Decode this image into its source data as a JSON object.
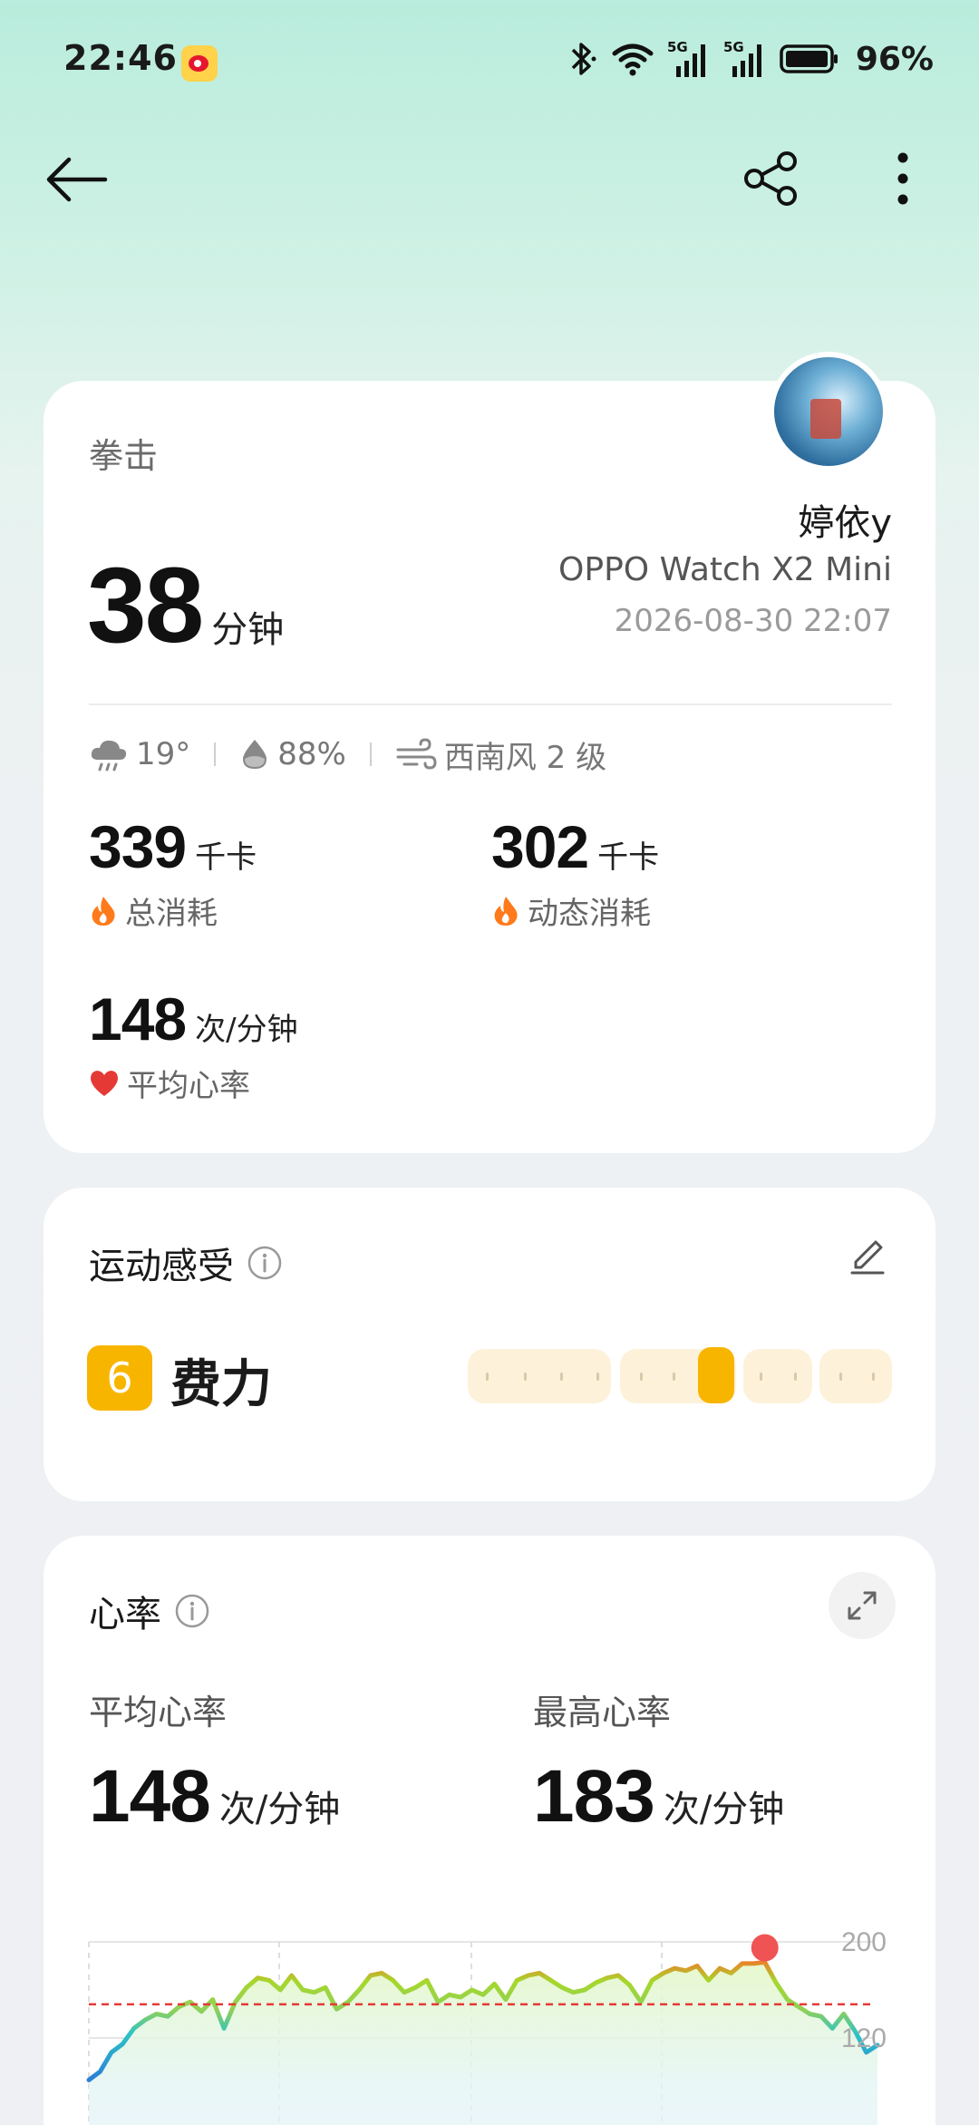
{
  "status_bar": {
    "time": "22:46",
    "battery_percent": "96%",
    "icons": [
      "weibo-icon",
      "bluetooth-icon",
      "wifi-icon",
      "signal-5g-icon",
      "signal-5g-icon",
      "battery-icon"
    ]
  },
  "toolbar": {
    "icons": [
      "back-arrow-icon",
      "share-icon",
      "more-vertical-icon"
    ]
  },
  "workout": {
    "sport": "拳击",
    "duration_value": "38",
    "duration_unit": "分钟",
    "user_name": "婷依y",
    "device": "OPPO Watch X2 Mini",
    "datetime": "2026-08-30 22:07",
    "weather": {
      "temperature": "19°",
      "humidity": "88%",
      "wind": "西南风 2 级"
    },
    "total_calories": {
      "value": "339",
      "unit": "千卡",
      "label": "总消耗"
    },
    "active_calories": {
      "value": "302",
      "unit": "千卡",
      "label": "动态消耗"
    },
    "avg_heart_rate": {
      "value": "148",
      "unit": "次/分钟",
      "label": "平均心率"
    }
  },
  "feeling": {
    "title": "运动感受",
    "level": "6",
    "level_label": "费力",
    "scale_fraction": 0.6
  },
  "heart_rate": {
    "title": "心率",
    "avg_label": "平均心率",
    "avg_value": "148",
    "avg_unit": "次/分钟",
    "max_label": "最高心率",
    "max_value": "183",
    "max_unit": "次/分钟"
  },
  "chart_data": {
    "type": "line",
    "y_ticks": [
      "200",
      "120"
    ],
    "ylim": [
      120,
      200
    ],
    "reference_line": 148,
    "max_point": 183,
    "series": [
      {
        "values": [
          85,
          92,
          108,
          115,
          128,
          135,
          140,
          138,
          146,
          150,
          142,
          152,
          128,
          150,
          162,
          170,
          168,
          160,
          172,
          160,
          158,
          162,
          144,
          150,
          160,
          172,
          174,
          168,
          158,
          162,
          168,
          150,
          156,
          154,
          160,
          156,
          165,
          152,
          168,
          172,
          174,
          168,
          162,
          158,
          160,
          166,
          170,
          172,
          164,
          150,
          168,
          174,
          178,
          176,
          180,
          168,
          178,
          174,
          182,
          182,
          183,
          166,
          152,
          146,
          140,
          138,
          128,
          140,
          126,
          108,
          114
        ]
      }
    ]
  }
}
